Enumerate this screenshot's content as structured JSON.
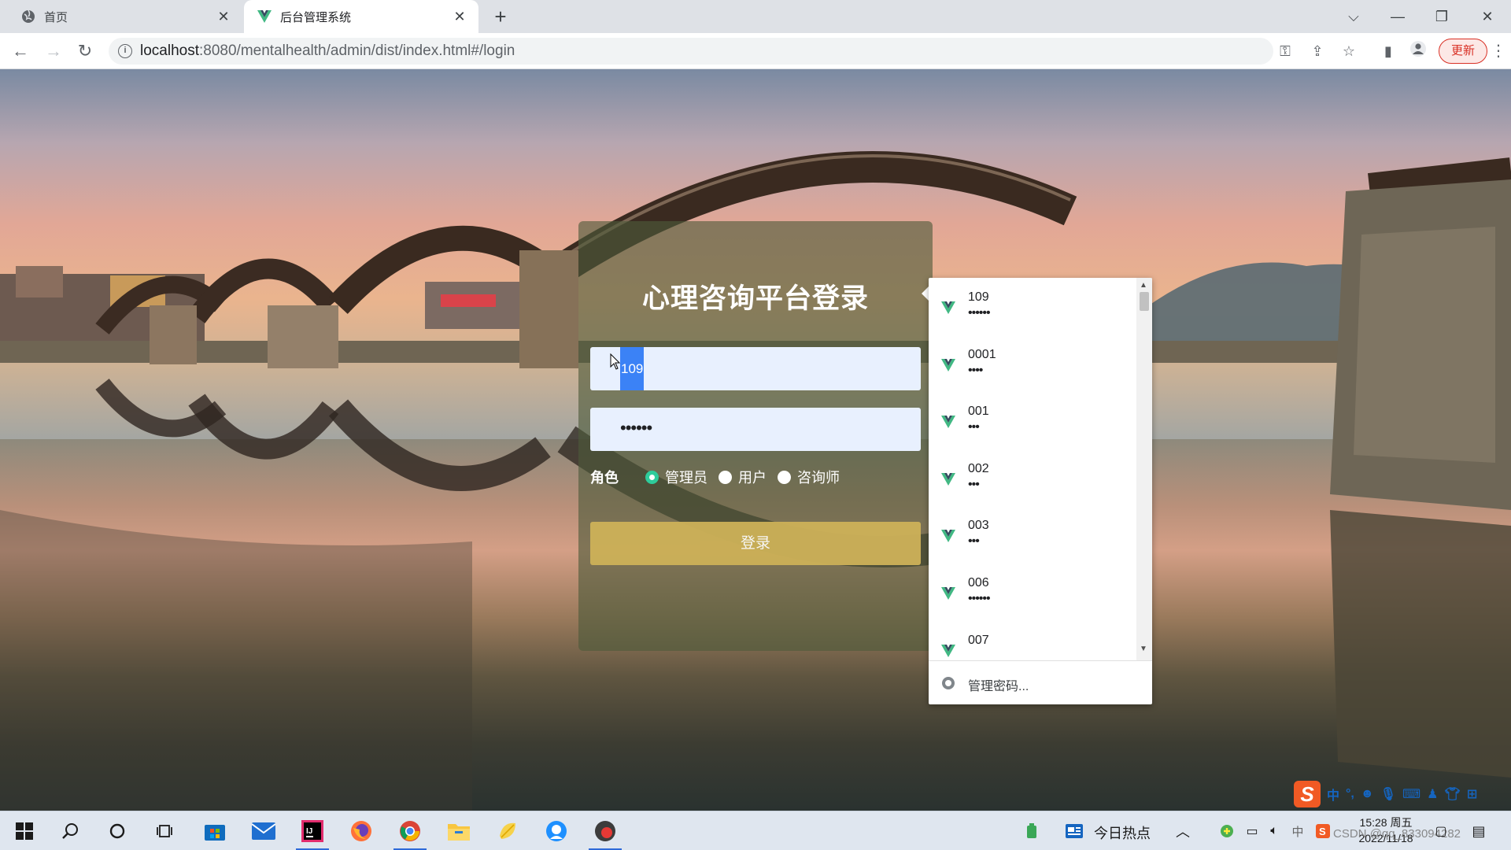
{
  "browser": {
    "tabs": [
      {
        "title": "首页",
        "icon": "globe-icon",
        "active": false
      },
      {
        "title": "后台管理系统",
        "icon": "vue-logo-icon",
        "active": true
      }
    ],
    "url_host": "localhost",
    "url_rest": ":8080/mentalhealth/admin/dist/index.html#/login",
    "update_label": "更新"
  },
  "login": {
    "title": "心理咨询平台登录",
    "username_value": "109",
    "password_value": "••••••",
    "role_label": "角色",
    "roles": [
      {
        "label": "管理员",
        "checked": true
      },
      {
        "label": "用户",
        "checked": false
      },
      {
        "label": "咨询师",
        "checked": false
      }
    ],
    "login_button": "登录",
    "accent_color": "#2ecc9b",
    "button_color": "#cdb158"
  },
  "autofill": {
    "items": [
      {
        "username": "109",
        "password": "••••••"
      },
      {
        "username": "0001",
        "password": "••••"
      },
      {
        "username": "001",
        "password": "•••"
      },
      {
        "username": "002",
        "password": "•••"
      },
      {
        "username": "003",
        "password": "•••"
      },
      {
        "username": "006",
        "password": "••••••"
      },
      {
        "username": "007",
        "password": ""
      }
    ],
    "manage_label": "管理密码..."
  },
  "ime": {
    "logo": "S",
    "mode": "中"
  },
  "taskbar": {
    "news_label": "今日热点",
    "time": "15:28 周五",
    "date": "2022/11/18",
    "watermark": "CSDN @qq_833094282"
  }
}
